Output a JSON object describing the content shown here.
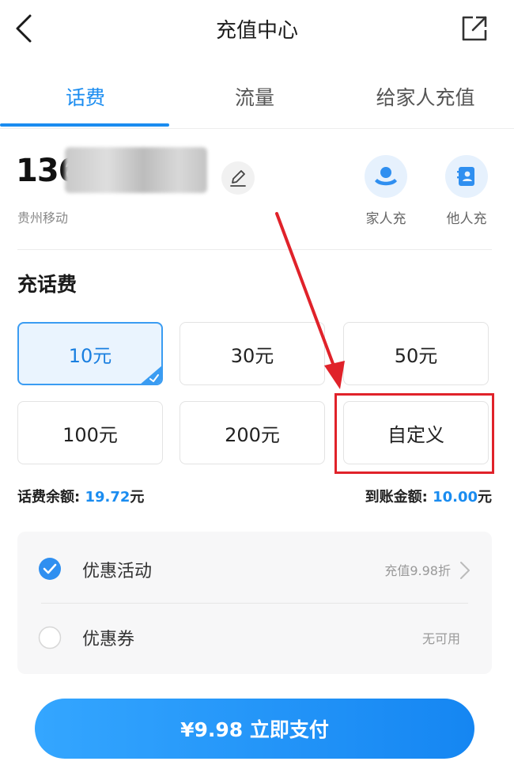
{
  "header": {
    "title": "充值中心"
  },
  "tabs": [
    {
      "label": "话费",
      "active": true
    },
    {
      "label": "流量",
      "active": false
    },
    {
      "label": "给家人充值",
      "active": false
    }
  ],
  "account": {
    "phone_prefix": "136",
    "carrier": "贵州移动",
    "quick_actions": [
      {
        "label": "家人充",
        "icon": "family-icon"
      },
      {
        "label": "他人充",
        "icon": "contact-book-icon"
      }
    ]
  },
  "recharge": {
    "section_title": "充话费",
    "amounts": [
      {
        "label": "10元",
        "selected": true
      },
      {
        "label": "30元",
        "selected": false
      },
      {
        "label": "50元",
        "selected": false
      },
      {
        "label": "100元",
        "selected": false
      },
      {
        "label": "200元",
        "selected": false
      },
      {
        "label": "自定义",
        "selected": false
      }
    ],
    "balance_label": "话费余额: ",
    "balance_value": "19.72",
    "balance_unit": "元",
    "arrival_label": "到账金额: ",
    "arrival_value": "10.00",
    "arrival_unit": "元"
  },
  "promotions": [
    {
      "label": "优惠活动",
      "value": "充值9.98折",
      "checked": true
    },
    {
      "label": "优惠券",
      "value": "无可用",
      "checked": false
    }
  ],
  "pay": {
    "label": "¥9.98 立即支付"
  },
  "colors": {
    "accent": "#1a8cf0",
    "annotation": "#e0222a"
  }
}
